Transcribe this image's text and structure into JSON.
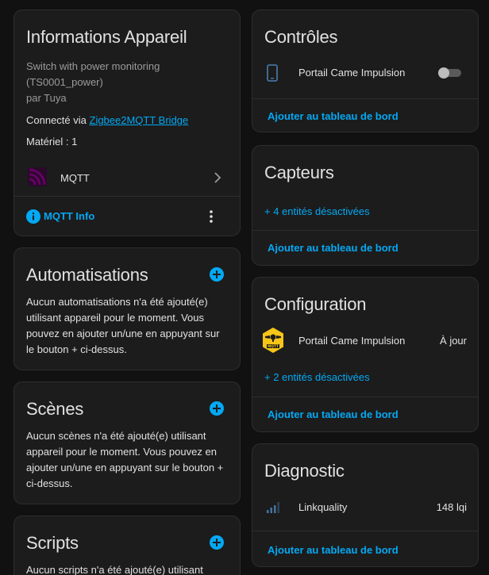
{
  "info": {
    "title": "Informations Appareil",
    "model": "Switch with power monitoring",
    "model_id": "(TS0001_power)",
    "manufacturer": "par Tuya",
    "connected_prefix": "Connecté via ",
    "connected_link": "Zigbee2MQTT Bridge",
    "hardware": "Matériel : 1",
    "integration": "MQTT",
    "mqtt_info": "MQTT Info",
    "accent_color": "#03a9f4",
    "mqtt_icon_color": "#660066"
  },
  "automations": {
    "title": "Automatisations",
    "description": "Aucun automatisations n'a été ajouté(e) utilisant appareil pour le moment. Vous pouvez en ajouter un/une en appuyant sur le bouton + ci-dessus."
  },
  "scenes": {
    "title": "Scènes",
    "description": "Aucun scènes n'a été ajouté(e) utilisant appareil pour le moment. Vous pouvez en ajouter un/une en appuyant sur le bouton + ci-dessus."
  },
  "scripts": {
    "title": "Scripts",
    "description": "Aucun scripts n'a été ajouté(e) utilisant"
  },
  "controls": {
    "title": "Contrôles",
    "entity_name": "Portail Came Impulsion",
    "entity_icon": "cellphone-icon",
    "toggle_on": false,
    "add_to_dashboard": "Ajouter au tableau de bord"
  },
  "sensors": {
    "title": "Capteurs",
    "disabled_entities": "+ 4 entités désactivées",
    "add_to_dashboard": "Ajouter au tableau de bord"
  },
  "configuration": {
    "title": "Configuration",
    "entity_name": "Portail Came Impulsion",
    "entity_state": "À jour",
    "entity_icon": "mqtt-logo-icon",
    "disabled_entities": "+ 2 entités désactivées",
    "add_to_dashboard": "Ajouter au tableau de bord"
  },
  "diagnostic": {
    "title": "Diagnostic",
    "entity_name": "Linkquality",
    "entity_state": "148 lqi",
    "entity_icon": "signal-icon",
    "add_to_dashboard": "Ajouter au tableau de bord"
  }
}
